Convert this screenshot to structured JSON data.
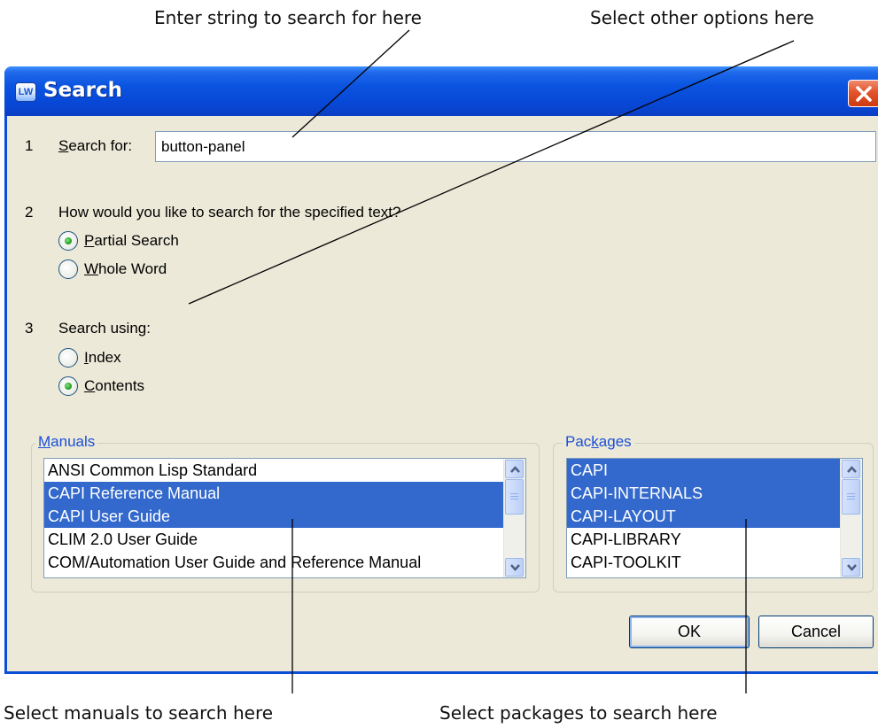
{
  "callouts": {
    "top_left": "Enter string to search for here",
    "top_right": "Select other options here",
    "bottom_left": "Select manuals to search here",
    "bottom_right": "Select packages to search here"
  },
  "window": {
    "title": "Search",
    "icon_glyph": "LW",
    "close_icon": "close-icon"
  },
  "step1": {
    "number": "1",
    "label_hotkey": "S",
    "label_rest": "earch for:",
    "value": "button-panel"
  },
  "step2": {
    "number": "2",
    "question": "How would you like to search for the specified text?",
    "options": [
      {
        "hotkey": "P",
        "rest": "artial Search",
        "checked": true
      },
      {
        "hotkey": "W",
        "rest": "hole Word",
        "checked": false
      }
    ]
  },
  "step3": {
    "number": "3",
    "label": "Search using:",
    "options": [
      {
        "hotkey": "I",
        "rest": "ndex",
        "checked": false
      },
      {
        "hotkey": "C",
        "rest": "ontents",
        "checked": true
      }
    ]
  },
  "manuals": {
    "legend_hotkey": "M",
    "legend_rest": "anuals",
    "items": [
      {
        "label": "ANSI Common Lisp Standard",
        "selected": false
      },
      {
        "label": "CAPI Reference Manual",
        "selected": true
      },
      {
        "label": "CAPI User Guide",
        "selected": true
      },
      {
        "label": "CLIM 2.0 User Guide",
        "selected": false
      },
      {
        "label": "COM/Automation User Guide and Reference Manual",
        "selected": false
      }
    ]
  },
  "packages": {
    "legend_pre": "Pac",
    "legend_hotkey": "k",
    "legend_post": "ages",
    "items": [
      {
        "label": "CAPI",
        "selected": true
      },
      {
        "label": "CAPI-INTERNALS",
        "selected": true
      },
      {
        "label": "CAPI-LAYOUT",
        "selected": true
      },
      {
        "label": "CAPI-LIBRARY",
        "selected": false
      },
      {
        "label": "CAPI-TOOLKIT",
        "selected": false
      }
    ]
  },
  "buttons": {
    "ok": "OK",
    "cancel": "Cancel"
  },
  "colors": {
    "titlebar": "#0a53e0",
    "selection": "#3369cc",
    "window_bg": "#ece9d8",
    "group_legend": "#1a4fd8"
  }
}
